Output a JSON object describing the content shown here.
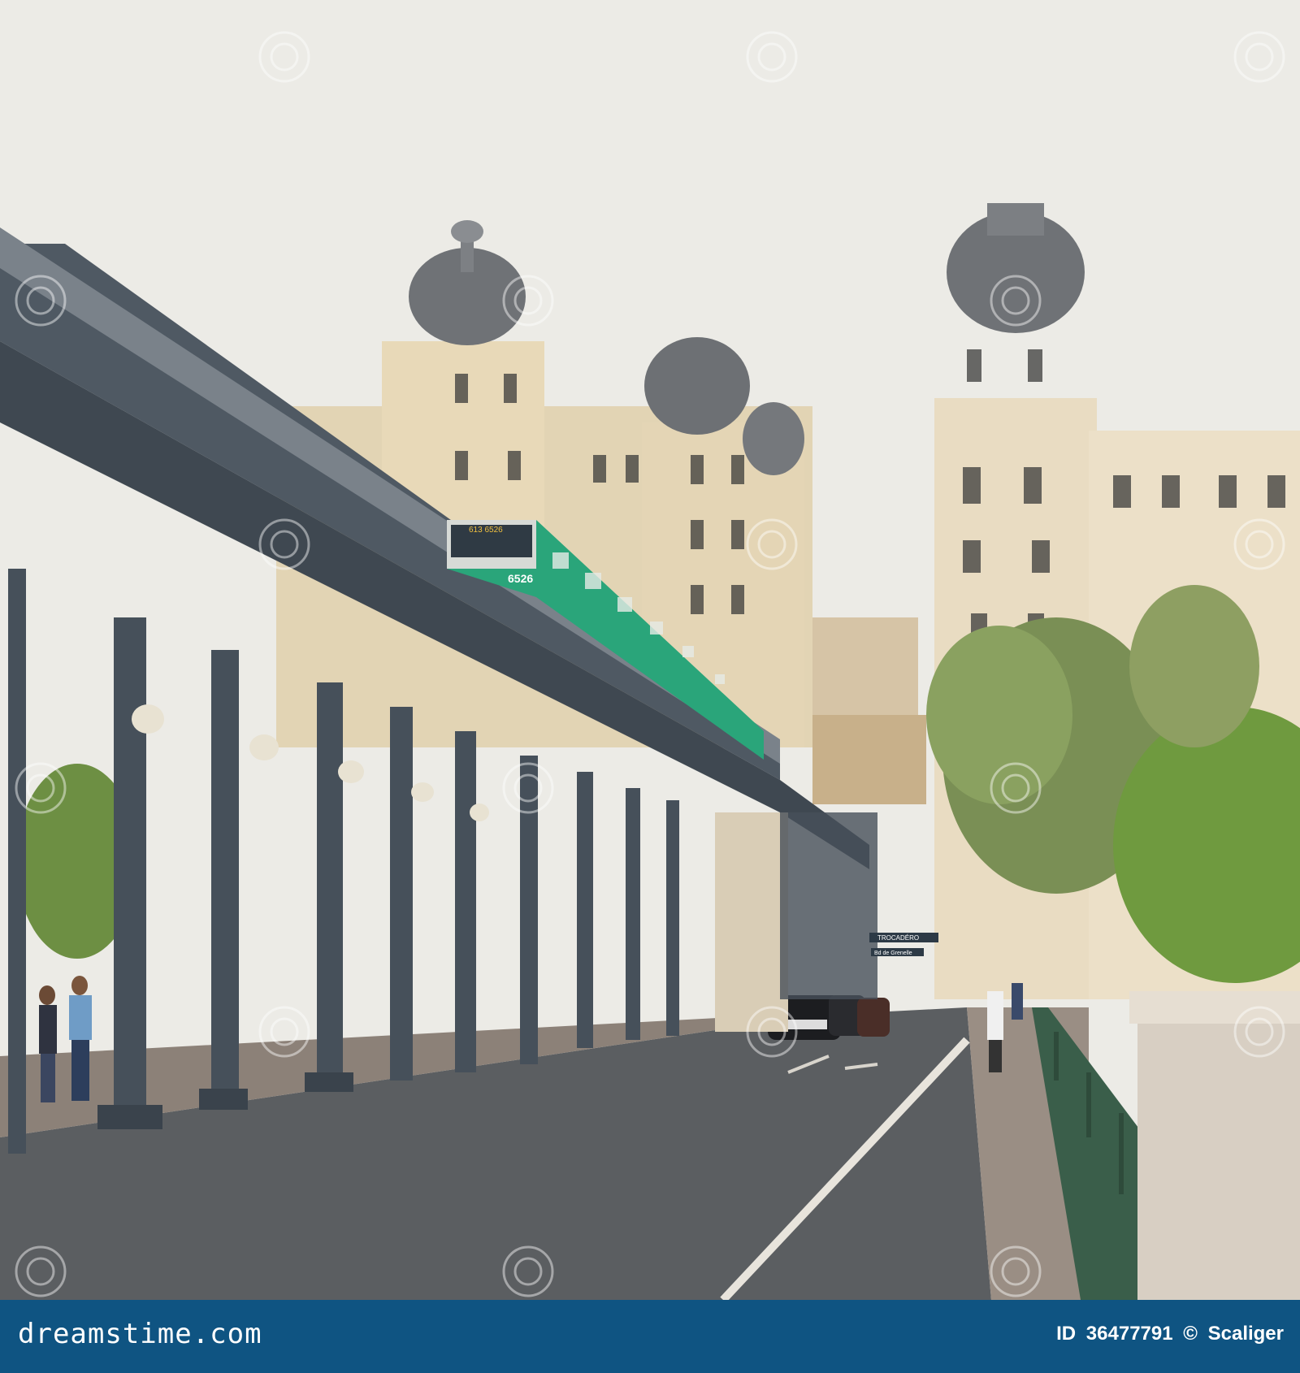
{
  "photo": {
    "subject": "Elevated metro viaduct and Haussmann buildings with domed towers",
    "train_number": "6526",
    "train_destination": "613 6526",
    "street_signs": [
      "TROCADÉRO",
      "Bd de Grenelle"
    ]
  },
  "watermark": {
    "text": "dreamstime"
  },
  "footer": {
    "brand": "dreamstime.com",
    "id_label": "ID",
    "id_value": "36477791",
    "copyright": "©",
    "author": "Scaliger"
  },
  "colors": {
    "footer_bg": "#0f5482",
    "sky": "#eeeeea",
    "train_green": "#2aa57a"
  }
}
